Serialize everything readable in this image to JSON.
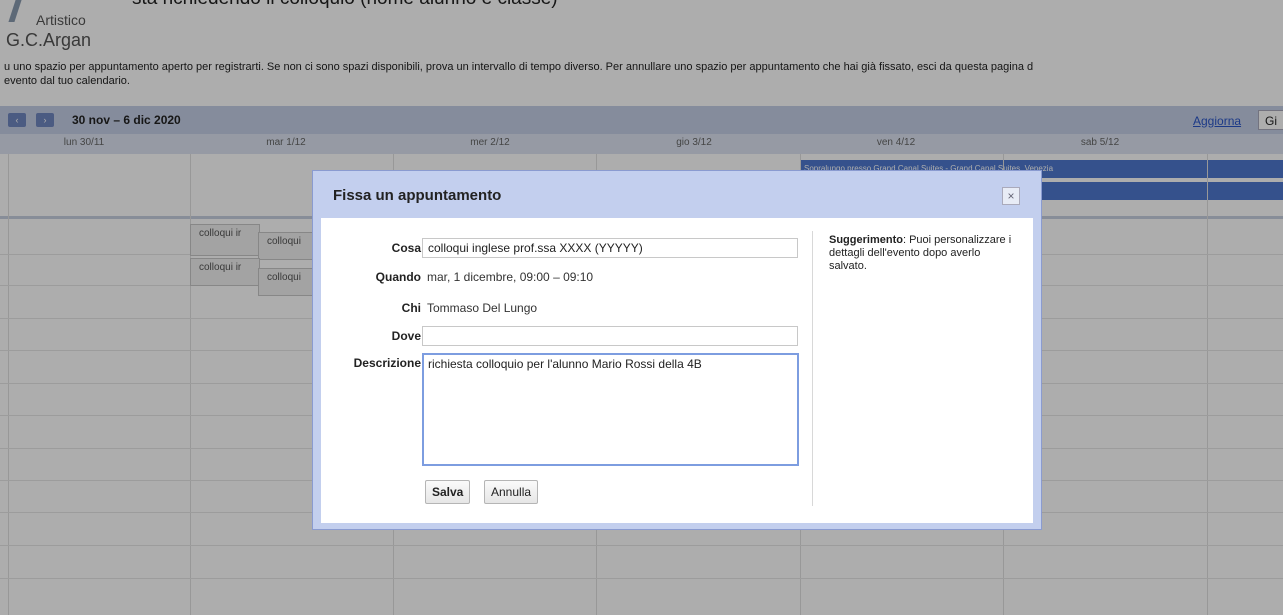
{
  "header": {
    "top_caption": "sta richiedendo il colloquio (nome alunno e classe)",
    "logo_line1": "Artistico",
    "logo_line2": "G.C.Argan",
    "intro_line1": "u uno spazio per appuntamento aperto per registrarti. Se non ci sono spazi disponibili, prova un intervallo di tempo diverso. Per annullare uno spazio per appuntamento che hai già fissato, esci da questa pagina d",
    "intro_line2": "evento dal tuo calendario."
  },
  "calendar": {
    "prev_icon": "‹",
    "next_icon": "›",
    "date_range": "30 nov – 6 dic 2020",
    "refresh_label": "Aggiorna",
    "view_label": "Gi",
    "days": [
      "lun 30/11",
      "mar 1/12",
      "mer 2/12",
      "gio 3/12",
      "ven 4/12",
      "sab 5/12"
    ],
    "allday_event1": "Sopralungo presso Grand Canal Suites - Grand Canal Suites, Venezia",
    "allday_event2": "al, Venezia",
    "slot_label": "colloqui ir",
    "slot_label_b": "colloqui"
  },
  "dialog": {
    "title": "Fissa un appuntamento",
    "close_icon": "×",
    "cosa_label": "Cosa",
    "cosa_value": "colloqui inglese prof.ssa XXXX (YYYYY)",
    "quando_label": "Quando",
    "quando_value": "mar, 1 dicembre, 09:00 – 09:10",
    "chi_label": "Chi",
    "chi_value": "Tommaso Del Lungo",
    "dove_label": "Dove",
    "dove_value": "",
    "descrizione_label": "Descrizione",
    "descrizione_value": "richiesta colloquio per l'alunno Mario Rossi della 4B",
    "save_label": "Salva",
    "cancel_label": "Annulla",
    "hint_bold": "Suggerimento",
    "hint_text": ": Puoi personalizzare i dettagli dell'evento dopo averlo salvato."
  },
  "colors": {
    "accent": "#4e78cf",
    "header_bg": "#c5cfe6",
    "dialog_frame": "#c3cfee"
  }
}
